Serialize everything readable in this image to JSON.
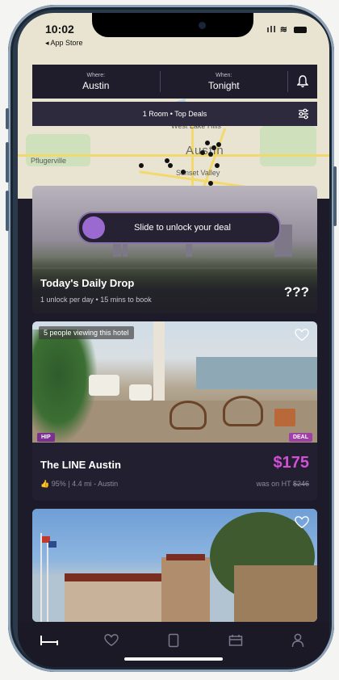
{
  "status_bar": {
    "time": "10:02",
    "back_app": "◂ App Store",
    "signal": "ıll"
  },
  "search": {
    "where_label": "Where:",
    "where_value": "Austin",
    "when_label": "When:",
    "when_value": "Tonight"
  },
  "filter": {
    "summary": "1 Room • Top Deals"
  },
  "map": {
    "labels": [
      "West Lake Hills",
      "Austin",
      "Sunset Valley",
      "Pflugerville"
    ]
  },
  "daily_drop": {
    "slider_text": "Slide to unlock your deal",
    "title": "Today's Daily Drop",
    "subtitle": "1 unlock per day • 15 mins to book",
    "price": "???"
  },
  "hotels": [
    {
      "viewing": "5 people viewing this hotel",
      "tag_left": "HIP",
      "tag_right": "DEAL",
      "name": "The LINE Austin",
      "price": "$175",
      "meta": "95% | 4.4 mi - Austin",
      "was_prefix": "was on HT ",
      "was_price": "$246"
    },
    {}
  ],
  "tabs": [
    "bed-icon",
    "heart-icon",
    "phone-icon",
    "bookings-icon",
    "profile-icon"
  ],
  "colors": {
    "accent": "#d24fd8",
    "card_bg": "#221f30",
    "tab_bg": "#1b1926"
  }
}
